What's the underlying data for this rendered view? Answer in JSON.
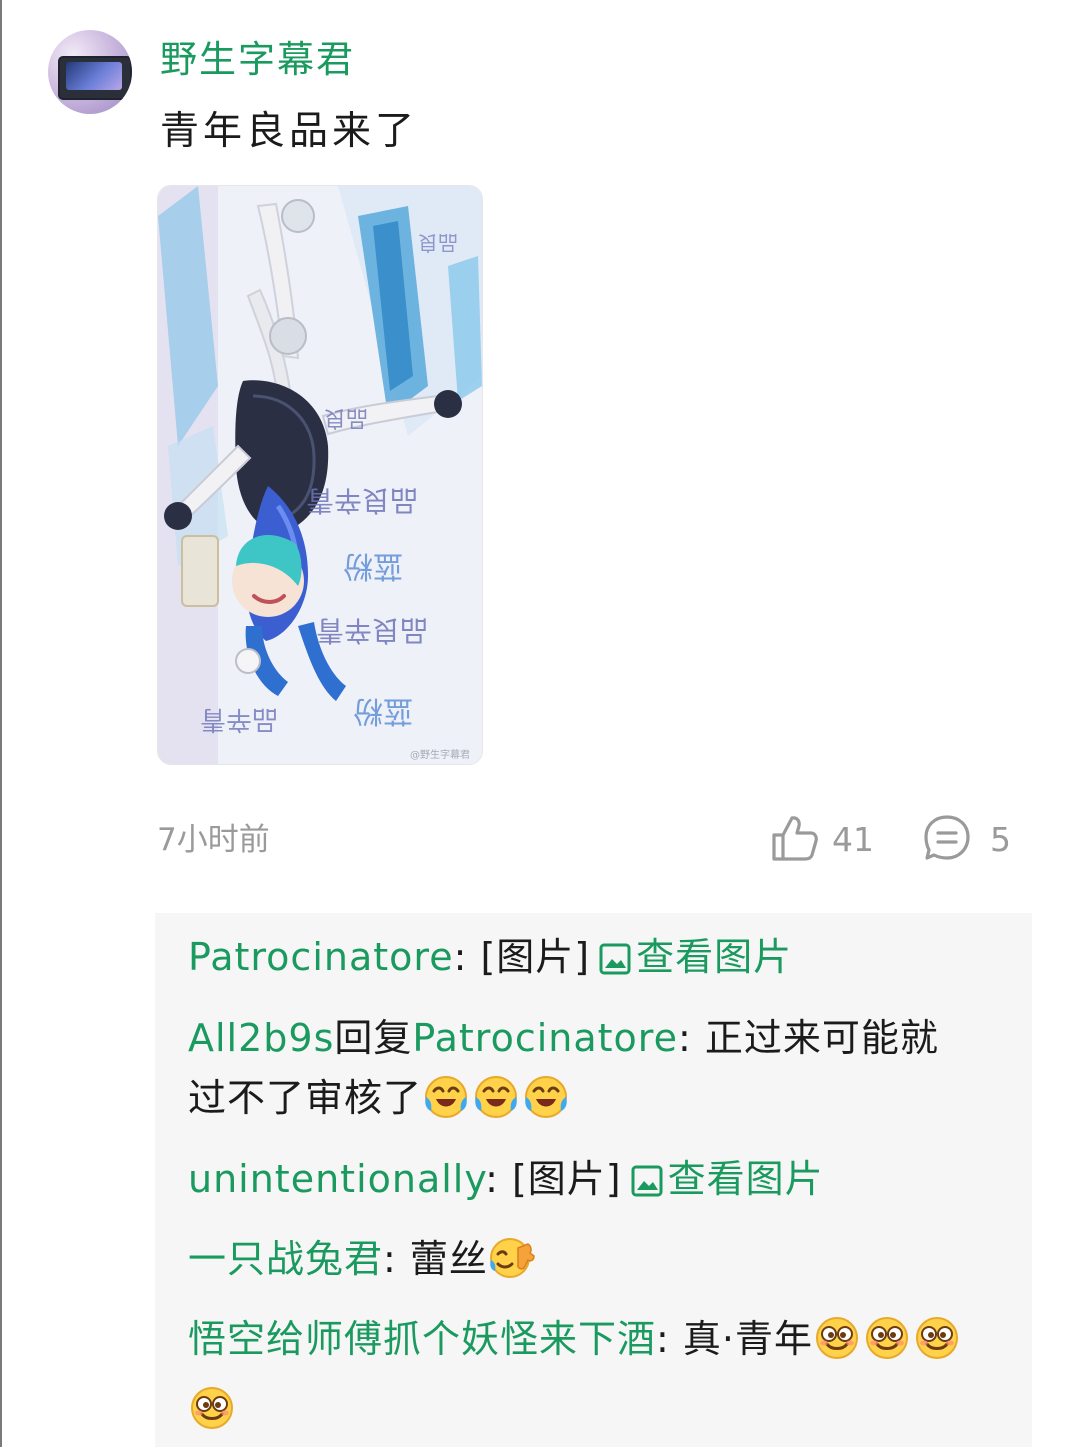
{
  "post": {
    "username": "野生字幕君",
    "text": "青年良品来了",
    "timestamp": "7小时前",
    "likes": "41",
    "comments": "5"
  },
  "image_watermark": "@野生字幕君",
  "replies": [
    {
      "name": "Patrocinatore",
      "colon": ": ",
      "content": "[图片]",
      "link": "查看图片"
    },
    {
      "name": "All2b9s",
      "reply_word": "回复",
      "target": "Patrocinatore",
      "colon": ": ",
      "content": "正过来可能就",
      "content2": "过不了审核了"
    },
    {
      "name": "unintentionally",
      "colon": ": ",
      "content": "[图片]",
      "link": "查看图片"
    },
    {
      "name": "一只战兔君",
      "colon": ": ",
      "content": "蕾丝"
    },
    {
      "name": "悟空给师傅抓个妖怪来下酒",
      "colon": ": ",
      "content": "真·青年"
    }
  ],
  "colors": {
    "accent_green": "#1a9a5f",
    "meta_gray": "#9a9a9a",
    "reply_bg": "#f6f6f6"
  },
  "icons": {
    "like": "thumbs-up-icon",
    "comment": "comment-bubble-icon",
    "image": "image-icon",
    "emoji_laugh_cry": "laugh-cry-emoji",
    "emoji_wave": "wave-emoji",
    "emoji_sly": "sly-grin-emoji"
  }
}
